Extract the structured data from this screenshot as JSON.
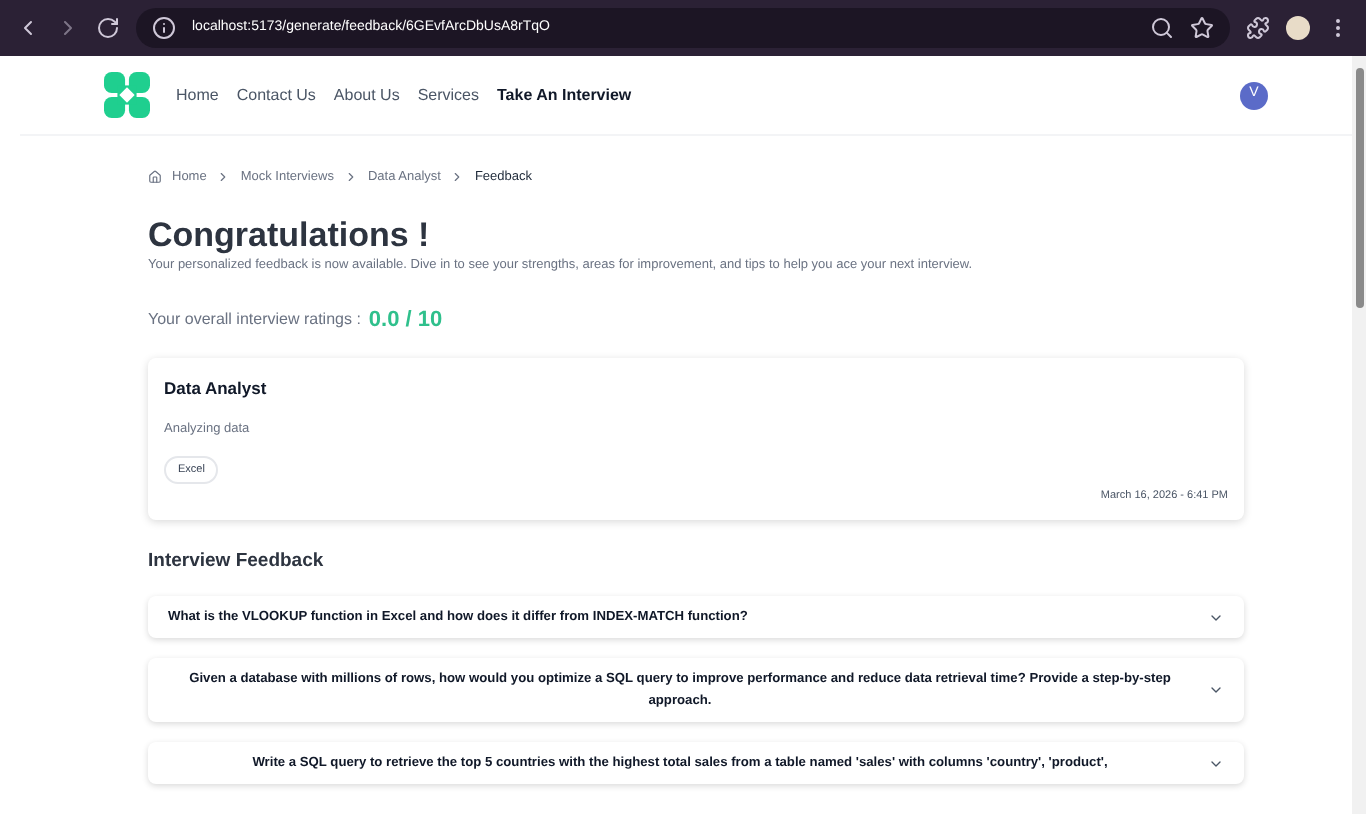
{
  "browser": {
    "url": "localhost:5173/generate/feedback/6GEvfArcDbUsA8rTqO"
  },
  "nav": {
    "items": [
      {
        "label": "Home",
        "selected": false
      },
      {
        "label": "Contact Us",
        "selected": false
      },
      {
        "label": "About Us",
        "selected": false
      },
      {
        "label": "Services",
        "selected": false
      },
      {
        "label": "Take An Interview",
        "selected": true
      }
    ],
    "avatar": "V"
  },
  "breadcrumb": [
    "Home",
    "Mock Interviews",
    "Data Analyst",
    "Feedback"
  ],
  "title": "Congratulations !",
  "subtitle": "Your personalized feedback is now available. Dive in to see your strengths, areas for improvement, and tips to help you ace your next interview.",
  "rating": {
    "label": "Your overall interview ratings :",
    "value": "0.0 / 10"
  },
  "card": {
    "title": "Data Analyst",
    "description": "Analyzing data",
    "tags": [
      "Excel"
    ],
    "date": "March 16, 2026 - 6:41 PM"
  },
  "feedback": {
    "heading": "Interview Feedback",
    "questions": [
      {
        "text": "What is the VLOOKUP function in Excel and how does it differ from INDEX-MATCH function?",
        "expanded": false
      },
      {
        "text": "Given a database with millions of rows, how would you optimize a SQL query to improve performance and reduce data retrieval time? Provide a step-by-step approach.",
        "expanded": false
      },
      {
        "text": "Write a SQL query to retrieve the top 5 countries with the highest total sales from a table named 'sales' with columns 'country', 'product',",
        "expanded": false
      }
    ]
  }
}
